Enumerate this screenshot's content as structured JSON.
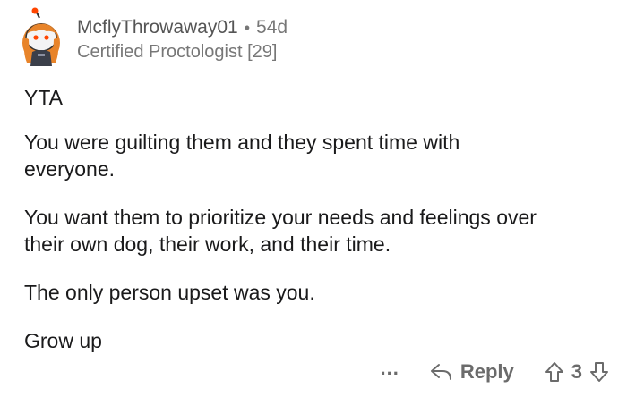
{
  "comment": {
    "username": "McflyThrowaway01",
    "separator": "•",
    "age": "54d",
    "flair": "Certified Proctologist [29]",
    "paragraphs": [
      "YTA",
      "You were guilting them and they spent time with everyone.",
      "You want them to prioritize your needs and feelings over their own dog, their work, and their time.",
      "The only person upset was you.",
      "Grow up"
    ]
  },
  "actions": {
    "more_label": "...",
    "reply_label": "Reply",
    "score": "3"
  },
  "icons": {
    "avatar": "snoo-avatar",
    "reply": "reply-arrow-icon",
    "upvote": "upvote-arrow-icon",
    "downvote": "downvote-arrow-icon"
  },
  "colors": {
    "text": "#1a1a1b",
    "meta": "#777777",
    "action": "#6b6b6b",
    "avatar_hair": "#e8842a",
    "avatar_face": "#f3f3f3"
  }
}
